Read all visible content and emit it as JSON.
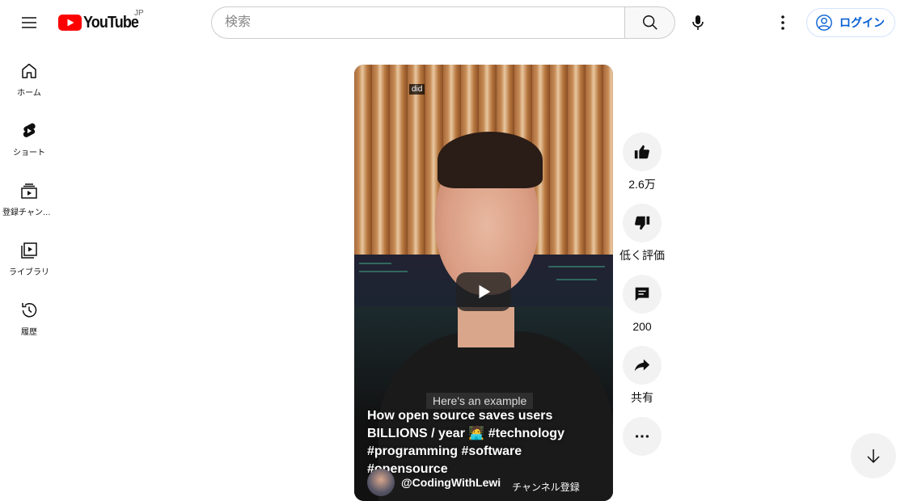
{
  "header": {
    "logo_text": "YouTube",
    "region": "JP",
    "search_placeholder": "検索",
    "login_label": "ログイン"
  },
  "sidebar": {
    "items": [
      {
        "label": "ホーム",
        "icon": "home-icon"
      },
      {
        "label": "ショート",
        "icon": "shorts-icon"
      },
      {
        "label": "登録チャンネル",
        "icon": "subscriptions-icon"
      },
      {
        "label": "ライブラリ",
        "icon": "library-icon"
      },
      {
        "label": "履歴",
        "icon": "history-icon"
      }
    ]
  },
  "video": {
    "caption_top": "did",
    "caption_sub": "Here's an example",
    "title": "How open source saves users BILLIONS / year 🧑‍💻 #technology #programming #software #opensource",
    "channel": "@CodingWithLewi",
    "subscribe_label": "チャンネル登録"
  },
  "actions": {
    "like_count": "2.6万",
    "dislike_label": "低く評価",
    "comment_count": "200",
    "share_label": "共有"
  },
  "colors": {
    "brand_red": "#ff0000",
    "link_blue": "#065fd4",
    "action_bg": "#f2f2f2"
  }
}
